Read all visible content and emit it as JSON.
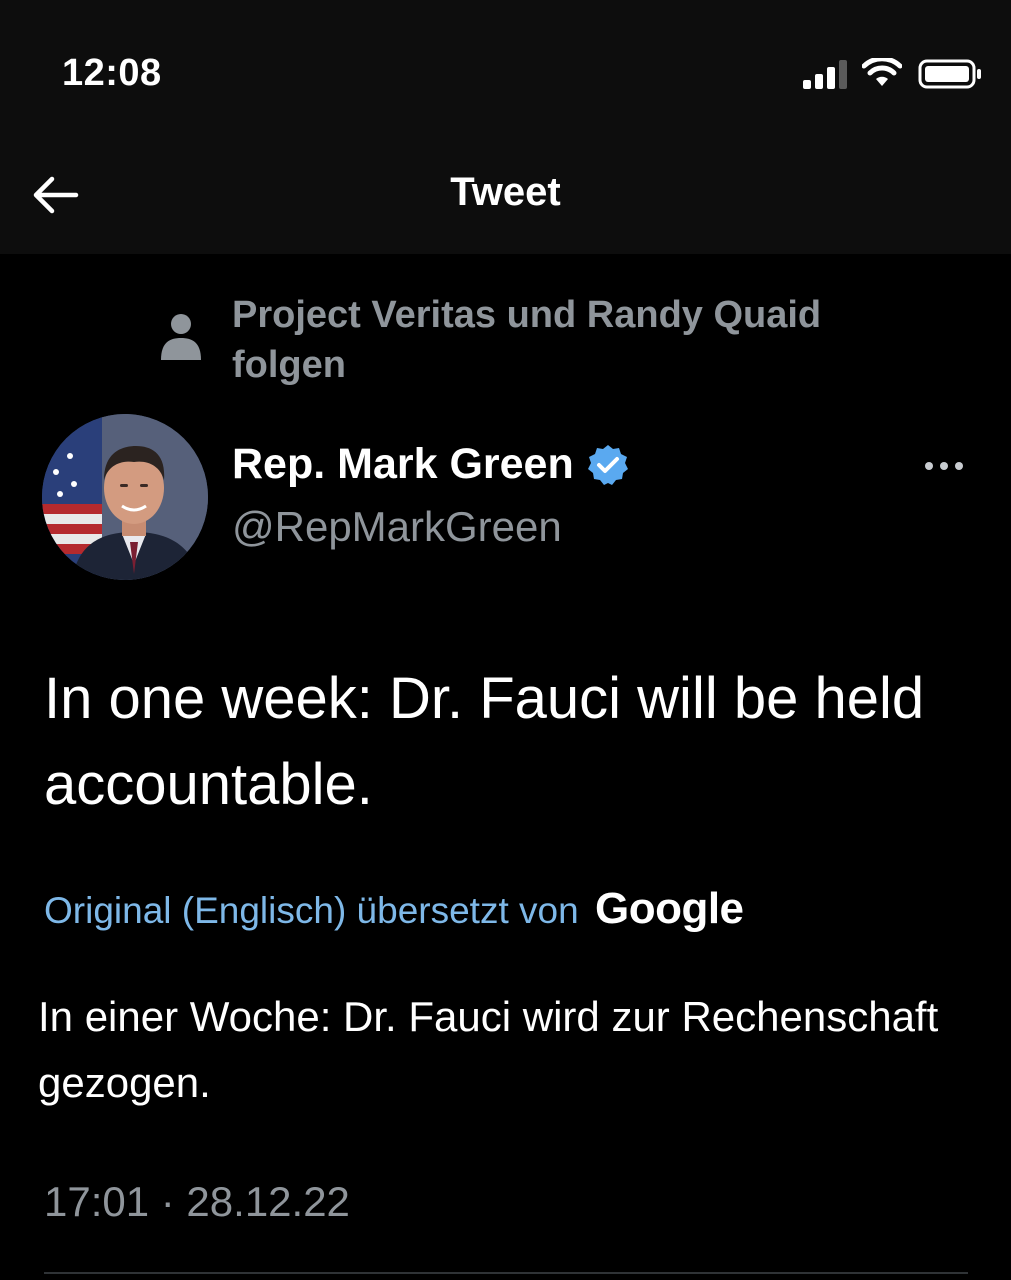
{
  "status_bar": {
    "time": "12:08",
    "signal_icon": "cellular-signal-icon",
    "wifi_icon": "wifi-icon",
    "battery_icon": "battery-icon"
  },
  "nav": {
    "back_icon": "arrow-left-icon",
    "title": "Tweet"
  },
  "social_context": {
    "icon": "person-icon",
    "text": "Project Veritas und Randy Quaid folgen"
  },
  "author": {
    "name": "Rep. Mark Green",
    "handle": "@RepMarkGreen",
    "verified_icon": "verified-badge-icon",
    "more_icon": "more-dots-icon"
  },
  "tweet": {
    "text": "In one week: Dr. Fauci will be held accountable.",
    "translation_label": "Original (Englisch) übersetzt von",
    "translation_provider": "Google",
    "translated_text": "In einer Woche: Dr. Fauci wird zur Rechenschaft gezogen.",
    "timestamp": "17:01 · 28.12.22"
  },
  "colors": {
    "background": "#000000",
    "header_background": "#0d0d0d",
    "secondary_text": "#8f959b",
    "link": "#7eb8e8",
    "verified": "#5aa9f0"
  }
}
